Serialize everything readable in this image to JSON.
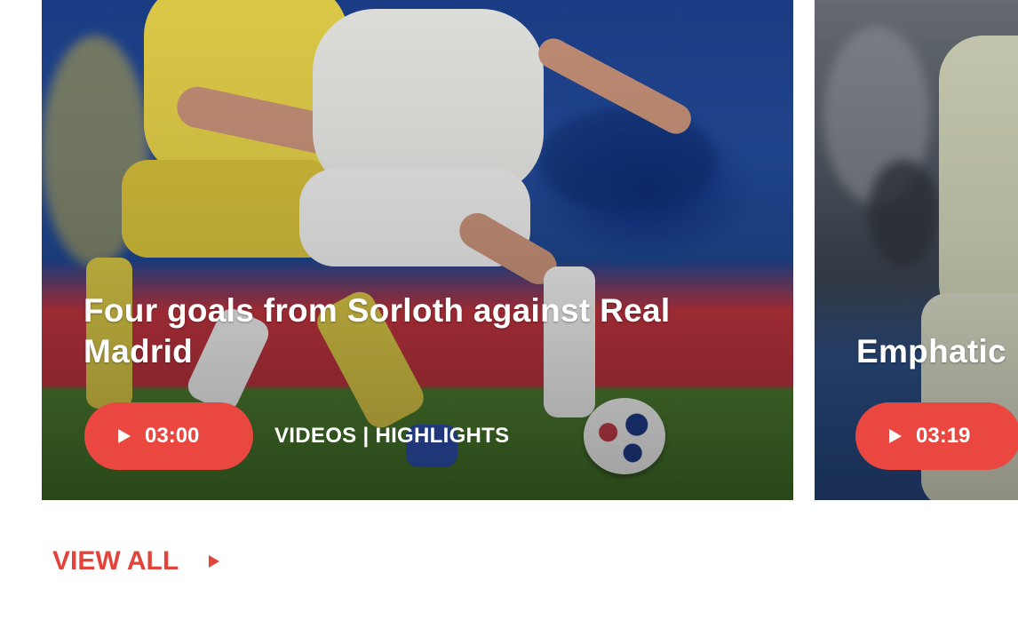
{
  "videos": [
    {
      "title": "Four goals from Sorloth against Real Madrid",
      "duration": "03:00",
      "category": "VIDEOS | HIGHLIGHTS",
      "play_icon": "play-icon"
    },
    {
      "title": "Emphatic",
      "duration": "03:19",
      "play_icon": "play-icon"
    }
  ],
  "view_all": {
    "label": "VIEW ALL",
    "icon": "arrow-right-icon"
  },
  "colors": {
    "accent": "#e9473f",
    "link": "#e2433b"
  }
}
